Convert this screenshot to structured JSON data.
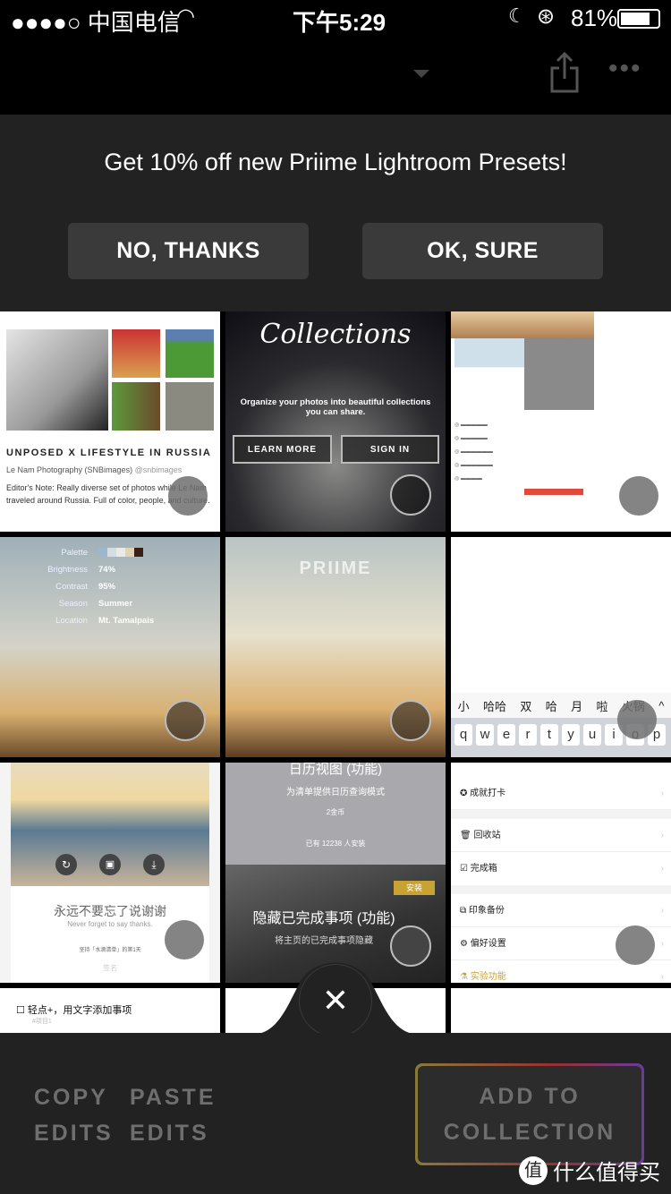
{
  "status": {
    "carrier": "●●●●○ 中国电信",
    "time": "下午5:29",
    "battery": "81%"
  },
  "topbar": {
    "icons": [
      "chevron-down-icon",
      "share-icon",
      "more-icon"
    ]
  },
  "promo": {
    "message": "Get 10% off new Priime Lightroom Presets!",
    "no_label": "NO, THANKS",
    "ok_label": "OK, SURE"
  },
  "grid": {
    "c1": {
      "title": "UNPOSED X LIFESTYLE IN RUSSIA",
      "author": "Le Nam Photography (SNBimages)",
      "handle": "@snbimages",
      "note": "Editor's Note: Really diverse set of photos while Le Nam traveled around Russia. Full of color, people, and culture."
    },
    "c2": {
      "logo": "Collections",
      "tagline": "Organize your photos into beautiful collections you can share.",
      "learn": "LEARN MORE",
      "signin": "SIGN IN"
    },
    "c4": {
      "rows": [
        {
          "k": "Palette",
          "v": ""
        },
        {
          "k": "Brightness",
          "v": "74%"
        },
        {
          "k": "Contrast",
          "v": "95%"
        },
        {
          "k": "Season",
          "v": "Summer"
        },
        {
          "k": "Location",
          "v": "Mt. Tamalpais"
        }
      ],
      "palette": [
        "#9fb7cc",
        "#d5dde2",
        "#e9ebe8",
        "#e0d4b4",
        "#3a1f14"
      ]
    },
    "c5": {
      "logo": "PRIIME"
    },
    "c6": {
      "candidates": [
        "小",
        "哈哈",
        "双",
        "哈",
        "月",
        "啦",
        "火锅"
      ],
      "keys": [
        "q",
        "w",
        "e",
        "r",
        "t",
        "y",
        "u",
        "i",
        "o",
        "p"
      ]
    },
    "c7": {
      "title": "永远不要忘了说谢谢",
      "subtitle": "Never forget to say thanks.",
      "footer": "坚持「水滴清单」的第1天",
      "sign": "签名"
    },
    "c8": {
      "top_title": "日历视图 (功能)",
      "top_sub": "为清单提供日历查询模式",
      "price": "2金币",
      "installs": "已有 12238 人安装",
      "badge": "安装",
      "title": "隐藏已完成事项 (功能)",
      "sub": "将主页的已完成事项隐藏"
    },
    "c9": {
      "items": [
        "成就打卡",
        "回收站",
        "完成箱",
        "印象备份",
        "偏好设置",
        "实验功能"
      ]
    },
    "c10": {
      "task": "轻点+，用文字添加事项",
      "tag": "#项目1"
    }
  },
  "bottom": {
    "copy": "COPY\nEDITS",
    "paste": "PASTE\nEDITS",
    "add": "ADD TO\nCOLLECTION",
    "watermark": "什么值得买"
  }
}
